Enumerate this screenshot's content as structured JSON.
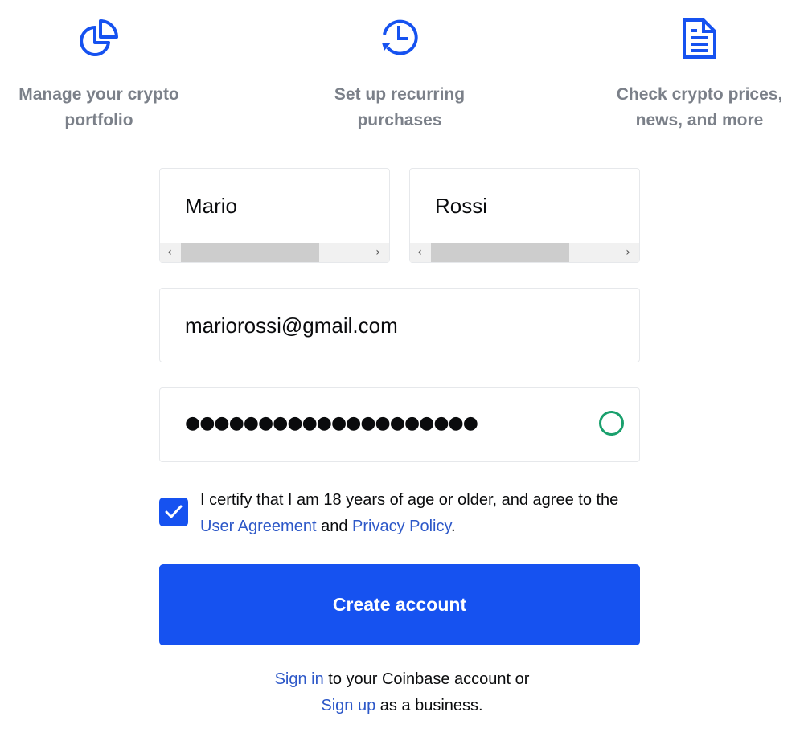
{
  "features": [
    {
      "icon": "pie-chart-icon",
      "line1": "Manage your crypto",
      "line2": "portfolio"
    },
    {
      "icon": "recurring-clock-icon",
      "line1": "Set up recurring",
      "line2": "purchases"
    },
    {
      "icon": "document-icon",
      "line1": "Check crypto prices,",
      "line2": "news, and more"
    }
  ],
  "form": {
    "first_name": "Mario",
    "last_name": "Rossi",
    "email": "mariorossi@gmail.com",
    "password_masked": "●●●●●●●●●●●●●●●●●●●●",
    "password_valid_indicator_color": "#1aa06d",
    "scroll_left": "‹",
    "scroll_right": "›"
  },
  "terms": {
    "checked": true,
    "text_before": "I certify that I am 18 years of age or older, and agree to the ",
    "user_agreement": "User Agreement",
    "and": " and ",
    "privacy_policy": "Privacy Policy",
    "period": "."
  },
  "create_button": "Create account",
  "footer": {
    "sign_in": "Sign in",
    "sign_in_rest": " to your Coinbase account or",
    "sign_up": "Sign up",
    "sign_up_rest": " as a business."
  },
  "colors": {
    "accent": "#1652f0",
    "link": "#2d58c8",
    "muted": "#7b8089"
  }
}
